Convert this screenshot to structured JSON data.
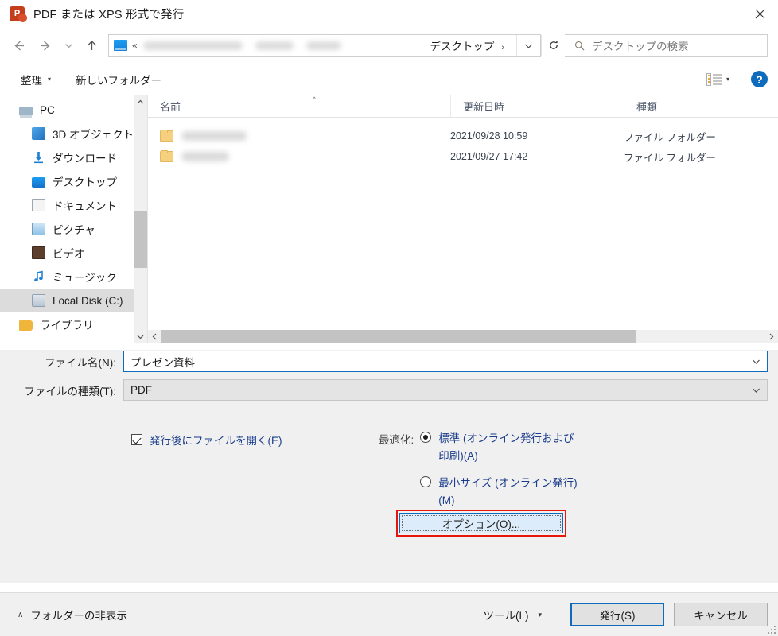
{
  "window": {
    "title": "PDF または XPS 形式で発行",
    "app_icon": "powerpoint-icon",
    "close_label": "×"
  },
  "address_bar": {
    "back_icon": "back-arrow-icon",
    "forward_icon": "forward-arrow-icon",
    "recent_icon": "recent-locations-icon",
    "up_icon": "up-arrow-icon",
    "overflow_chevron": "«",
    "current_folder": "デスクトップ",
    "crumb_arrow": "›",
    "dropdown_icon": "chevron-down-icon",
    "refresh_icon": "refresh-icon",
    "path_segments_redacted": 3
  },
  "search": {
    "placeholder": "デスクトップの検索",
    "icon": "search-icon"
  },
  "toolbar": {
    "organize_label": "整理",
    "organize_caret": "▾",
    "new_folder_label": "新しいフォルダー",
    "view_icon": "view-options-icon",
    "view_caret": "▾",
    "help_label": "?"
  },
  "sidebar": {
    "items": [
      {
        "label": "PC",
        "icon": "pc-icon",
        "indent": false,
        "selected": false
      },
      {
        "label": "3D オブジェクト",
        "icon": "3d-objects-icon",
        "indent": true,
        "selected": false
      },
      {
        "label": "ダウンロード",
        "icon": "downloads-icon",
        "indent": true,
        "selected": false
      },
      {
        "label": "デスクトップ",
        "icon": "desktop-icon",
        "indent": true,
        "selected": false
      },
      {
        "label": "ドキュメント",
        "icon": "documents-icon",
        "indent": true,
        "selected": false
      },
      {
        "label": "ピクチャ",
        "icon": "pictures-icon",
        "indent": true,
        "selected": false
      },
      {
        "label": "ビデオ",
        "icon": "videos-icon",
        "indent": true,
        "selected": false
      },
      {
        "label": "ミュージック",
        "icon": "music-icon",
        "indent": true,
        "selected": false
      },
      {
        "label": "Local Disk (C:)",
        "icon": "disk-icon",
        "indent": true,
        "selected": true
      },
      {
        "label": "ライブラリ",
        "icon": "library-icon",
        "indent": false,
        "selected": false
      }
    ],
    "scroll_up_icon": "chevron-up-icon",
    "scroll_down_icon": "chevron-down-icon"
  },
  "file_list": {
    "columns": [
      "名前",
      "更新日時",
      "種類"
    ],
    "sort_indicator": "^",
    "rows": [
      {
        "name": "",
        "name_redacted": true,
        "date": "2021/09/28 10:59",
        "type": "ファイル フォルダー"
      },
      {
        "name": "",
        "name_redacted": true,
        "date": "2021/09/27 17:42",
        "type": "ファイル フォルダー"
      }
    ],
    "hscroll_left_icon": "chevron-left-icon",
    "hscroll_right_icon": "chevron-right-icon"
  },
  "form": {
    "filename_label": "ファイル名(N):",
    "filename_value": "プレゼン資料",
    "filetype_label": "ファイルの種類(T):",
    "filetype_value": "PDF",
    "dropdown_icon": "chevron-down-icon"
  },
  "options": {
    "open_after_publish_label": "発行後にファイルを開く(E)",
    "open_after_publish_checked": true,
    "optimize_caption": "最適化:",
    "radios": [
      {
        "label": "標準 (オンライン発行および印刷)(A)",
        "selected": true
      },
      {
        "label": "最小サイズ (オンライン発行)(M)",
        "selected": false
      }
    ],
    "options_button_label": "オプション(O)...",
    "highlight_color": "#e8170c"
  },
  "bottom": {
    "hide_folders_label": "フォルダーの非表示",
    "hide_folders_caret": "∧",
    "tools_label": "ツール(L)",
    "tools_caret": "▾",
    "publish_label": "発行(S)",
    "cancel_label": "キャンセル"
  }
}
